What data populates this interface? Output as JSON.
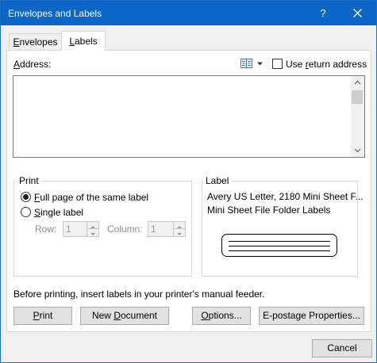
{
  "window": {
    "title": "Envelopes and Labels",
    "help_label": "?",
    "close_icon": "close-icon"
  },
  "tabs": [
    {
      "label_mnemonic": "E",
      "label_rest": "nvelopes",
      "active": false
    },
    {
      "label_mnemonic": "L",
      "label_rest": "abels",
      "active": true
    }
  ],
  "address": {
    "label_mnemonic": "A",
    "label_rest": "ddress:",
    "value": "",
    "address_book_icon": "address-book-icon",
    "use_return_pre": "Use ",
    "use_return_mnemonic": "r",
    "use_return_post": "eturn address",
    "use_return_checked": false
  },
  "print_group": {
    "title": "Print",
    "full_page_mnemonic": "F",
    "full_page_rest": "ull page of the same label",
    "full_page_selected": true,
    "single_label_mnemonic": "S",
    "single_label_rest": "ingle label",
    "single_label_selected": false,
    "row_label": "Row:",
    "row_value": "1",
    "column_label": "Column:",
    "column_value": "1"
  },
  "label_group": {
    "title": "Label",
    "line1": "Avery US Letter, 2180 Mini Sheet F...",
    "line2": "Mini Sheet File Folder Labels"
  },
  "hint": "Before printing, insert labels in your printer's manual feeder.",
  "buttons": {
    "print_mnemonic": "P",
    "print_rest": "rint",
    "new_doc_pre": "New ",
    "new_doc_mnemonic": "D",
    "new_doc_post": "ocument",
    "options_mnemonic": "O",
    "options_rest": "ptions...",
    "epostage": "E-postage Properties...",
    "cancel": "Cancel"
  }
}
